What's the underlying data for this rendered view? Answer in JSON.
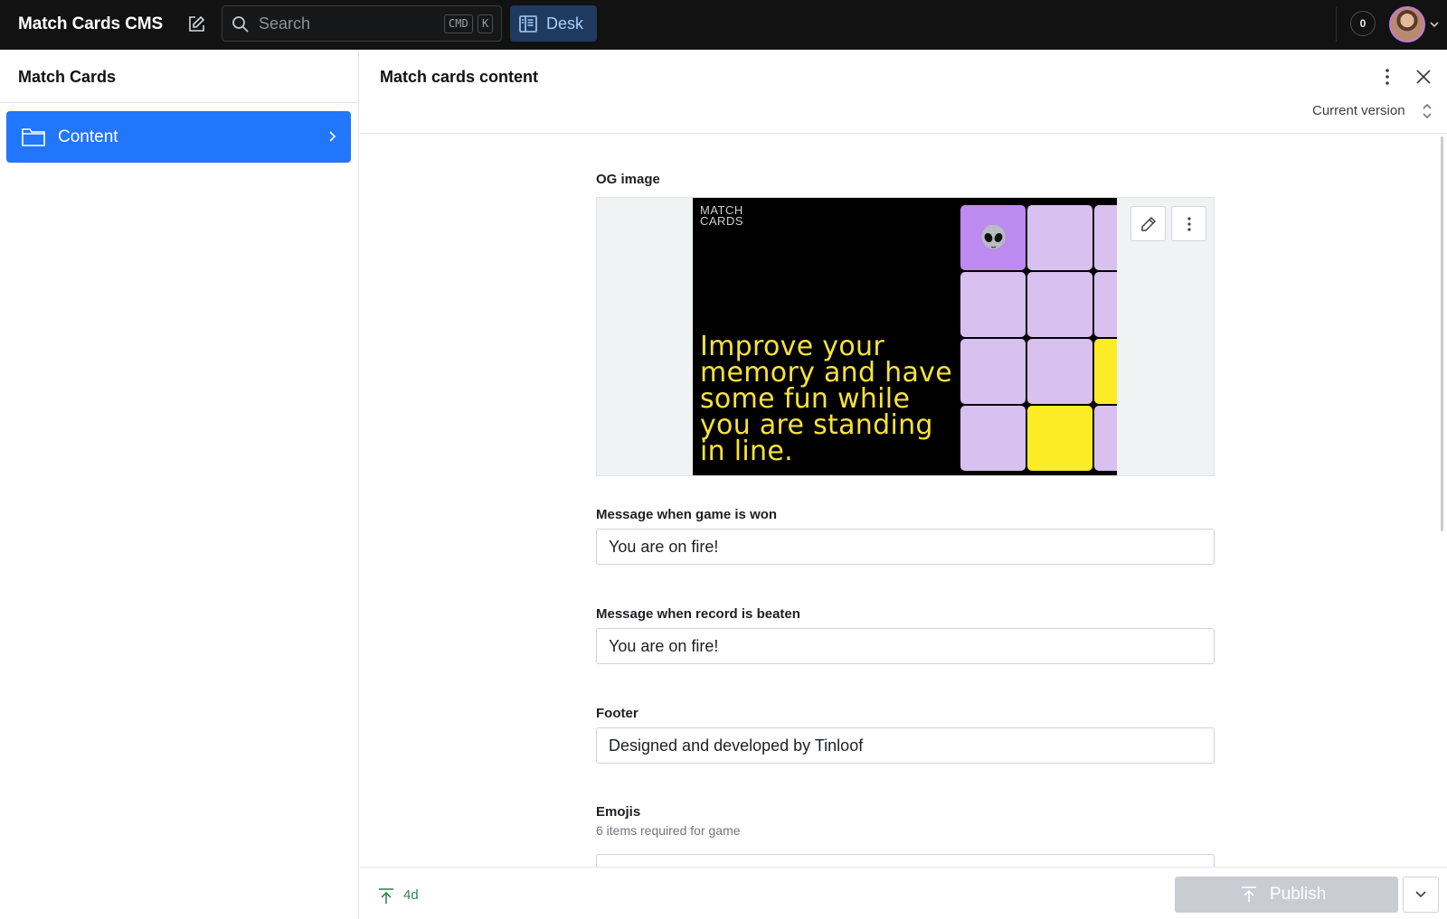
{
  "app": {
    "title": "Match Cards CMS"
  },
  "search": {
    "placeholder": "Search",
    "shortcut_cmd": "CMD",
    "shortcut_key": "K"
  },
  "nav": {
    "desk_label": "Desk"
  },
  "notifications": {
    "count": "0"
  },
  "left_pane": {
    "title": "Match Cards",
    "items": [
      {
        "label": "Content",
        "icon": "folder-icon"
      }
    ]
  },
  "document": {
    "title": "Match cards content",
    "version_label": "Current version",
    "fields": {
      "og_image": {
        "label": "OG image",
        "brand_line1": "MATCH",
        "brand_line2": "CARDS",
        "tagline": "Improve your memory and have some fun while you are standing in line."
      },
      "won_message": {
        "label": "Message when game is won",
        "value": "You are on fire!"
      },
      "record_message": {
        "label": "Message when record is beaten",
        "value": "You are on fire!"
      },
      "footer": {
        "label": "Footer",
        "value": "Designed and developed by Tinloof"
      },
      "emojis": {
        "label": "Emojis",
        "description": "6 items required for game"
      }
    }
  },
  "footer_bar": {
    "status": "4d",
    "publish_label": "Publish"
  },
  "colors": {
    "accent": "#2276fc",
    "tagline_yellow": "#f7e23a",
    "tile_lavender": "#d8c1ee",
    "tile_purple": "#bd8af0",
    "status_green": "#2e8a4a"
  }
}
